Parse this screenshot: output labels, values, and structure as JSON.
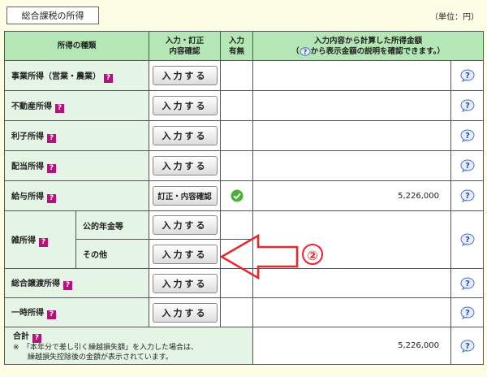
{
  "tab_label": "総合課税の所得",
  "unit_label": "（単位：円）",
  "header": {
    "col_type": "所得の種類",
    "col_entry_line1": "入力・訂正",
    "col_entry_line2": "内容確認",
    "col_has_line1": "入力",
    "col_has_line2": "有無",
    "col_amount_line1": "入力内容から計算した所得金額",
    "col_amount_line2_pre": "（",
    "col_amount_line2_post": "から表示金額の説明を確認できます。）"
  },
  "rows": {
    "business": {
      "label": "事業所得（営業・農業）",
      "button": "入力する"
    },
    "realestate": {
      "label": "不動産所得",
      "button": "入力する"
    },
    "interest": {
      "label": "利子所得",
      "button": "入力する"
    },
    "dividend": {
      "label": "配当所得",
      "button": "入力する"
    },
    "salary": {
      "label": "給与所得",
      "button": "訂正・内容確認",
      "amount": "5,226,000"
    },
    "misc": {
      "label": "雑所得",
      "pension_label": "公的年金等",
      "pension_button": "入力する",
      "other_label": "その他",
      "other_button": "入力する"
    },
    "transfer": {
      "label": "総合譲渡所得",
      "button": "入力する"
    },
    "temporary": {
      "label": "一時所得",
      "button": "入力する"
    },
    "total": {
      "label": "合計",
      "note_line1": "※　「本年分で差し引く繰越損失額」を入力した場合は、",
      "note_line2": "　　繰越損失控除後の金額が表示されています。",
      "amount": "5,226,000"
    }
  },
  "question_mark": "?",
  "annotation_number": "②",
  "colors": {
    "header_green": "#b5e6b5",
    "label_green": "#e5f5e5",
    "check_green": "#4caf3a",
    "arrow_red": "#e8282e",
    "help_magenta": "#b0167a"
  }
}
